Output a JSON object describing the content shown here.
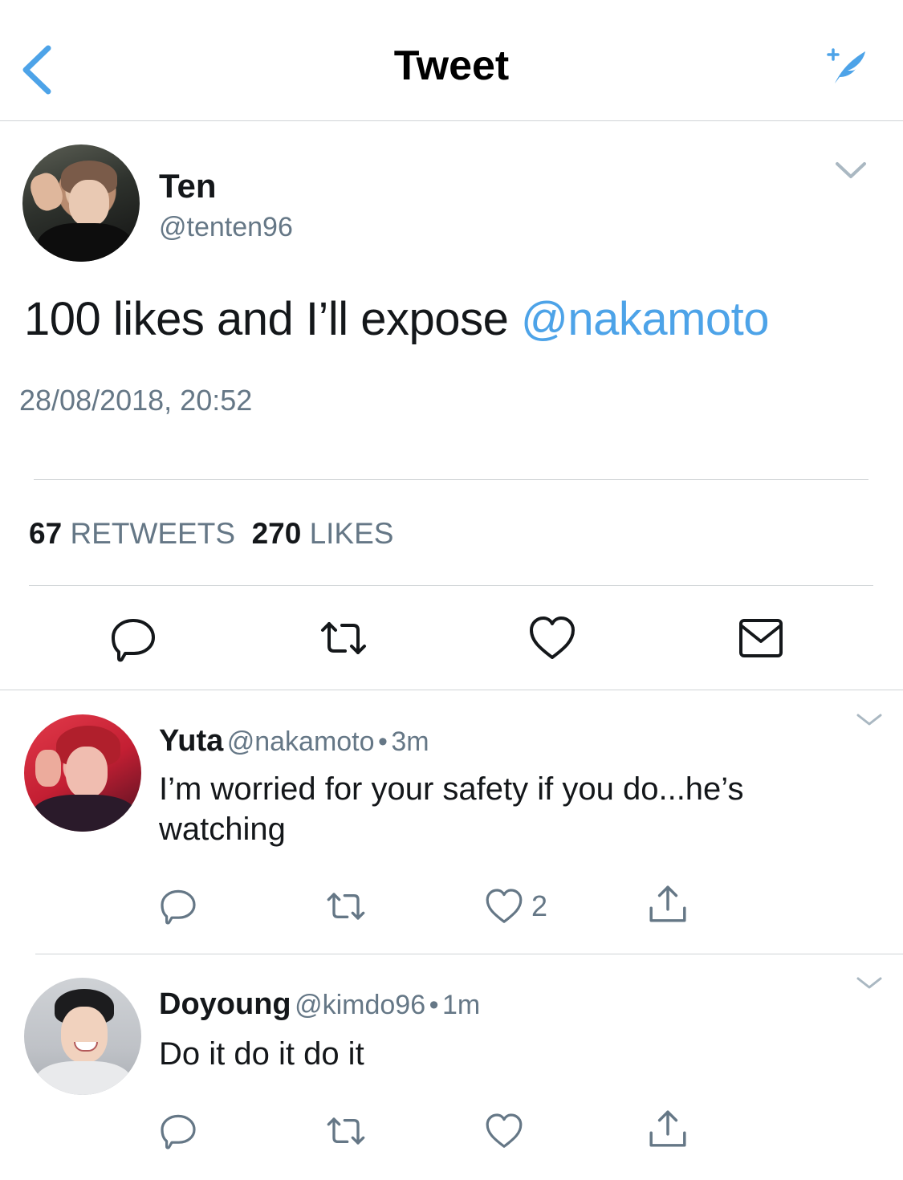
{
  "header": {
    "title": "Tweet",
    "back_icon": "chevron-left-icon",
    "compose_icon": "compose-tweet-icon",
    "accent_color": "#4da3e8"
  },
  "main_tweet": {
    "author_name": "Ten",
    "author_handle": "@tenten96",
    "text_prefix": "100 likes and I’ll expose ",
    "mention": "@nakamoto",
    "timestamp": "28/08/2018, 20:52",
    "retweets_count": "67",
    "retweets_label": "RETWEETS",
    "likes_count": "270",
    "likes_label": "LIKES",
    "actions": [
      "reply-icon",
      "retweet-icon",
      "like-icon",
      "direct-message-icon"
    ]
  },
  "replies": [
    {
      "name": "Yuta",
      "handle": "@nakamoto",
      "separator": "•",
      "time": "3m",
      "text": "I’m worried for your safety if you do...he’s watching",
      "like_count": "2"
    },
    {
      "name": "Doyoung",
      "handle": "@kimdo96",
      "separator": "•",
      "time": "1m",
      "text": "Do it do it do it",
      "like_count": ""
    }
  ]
}
